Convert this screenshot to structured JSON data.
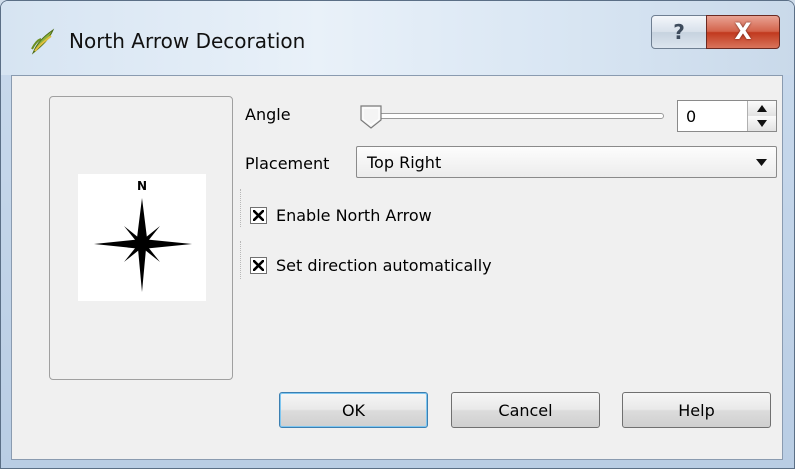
{
  "window": {
    "title": "North Arrow Decoration",
    "help_glyph": "?",
    "close_glyph": "X"
  },
  "preview": {
    "north_label": "N"
  },
  "angle": {
    "label": "Angle",
    "value": "0",
    "slider_fraction": 0
  },
  "placement": {
    "label": "Placement",
    "value": "Top Right"
  },
  "checkboxes": {
    "enable_label": "Enable North Arrow",
    "enable_checked": true,
    "auto_label": "Set direction automatically",
    "auto_checked": true
  },
  "buttons": {
    "ok": "OK",
    "cancel": "Cancel",
    "help": "Help"
  }
}
